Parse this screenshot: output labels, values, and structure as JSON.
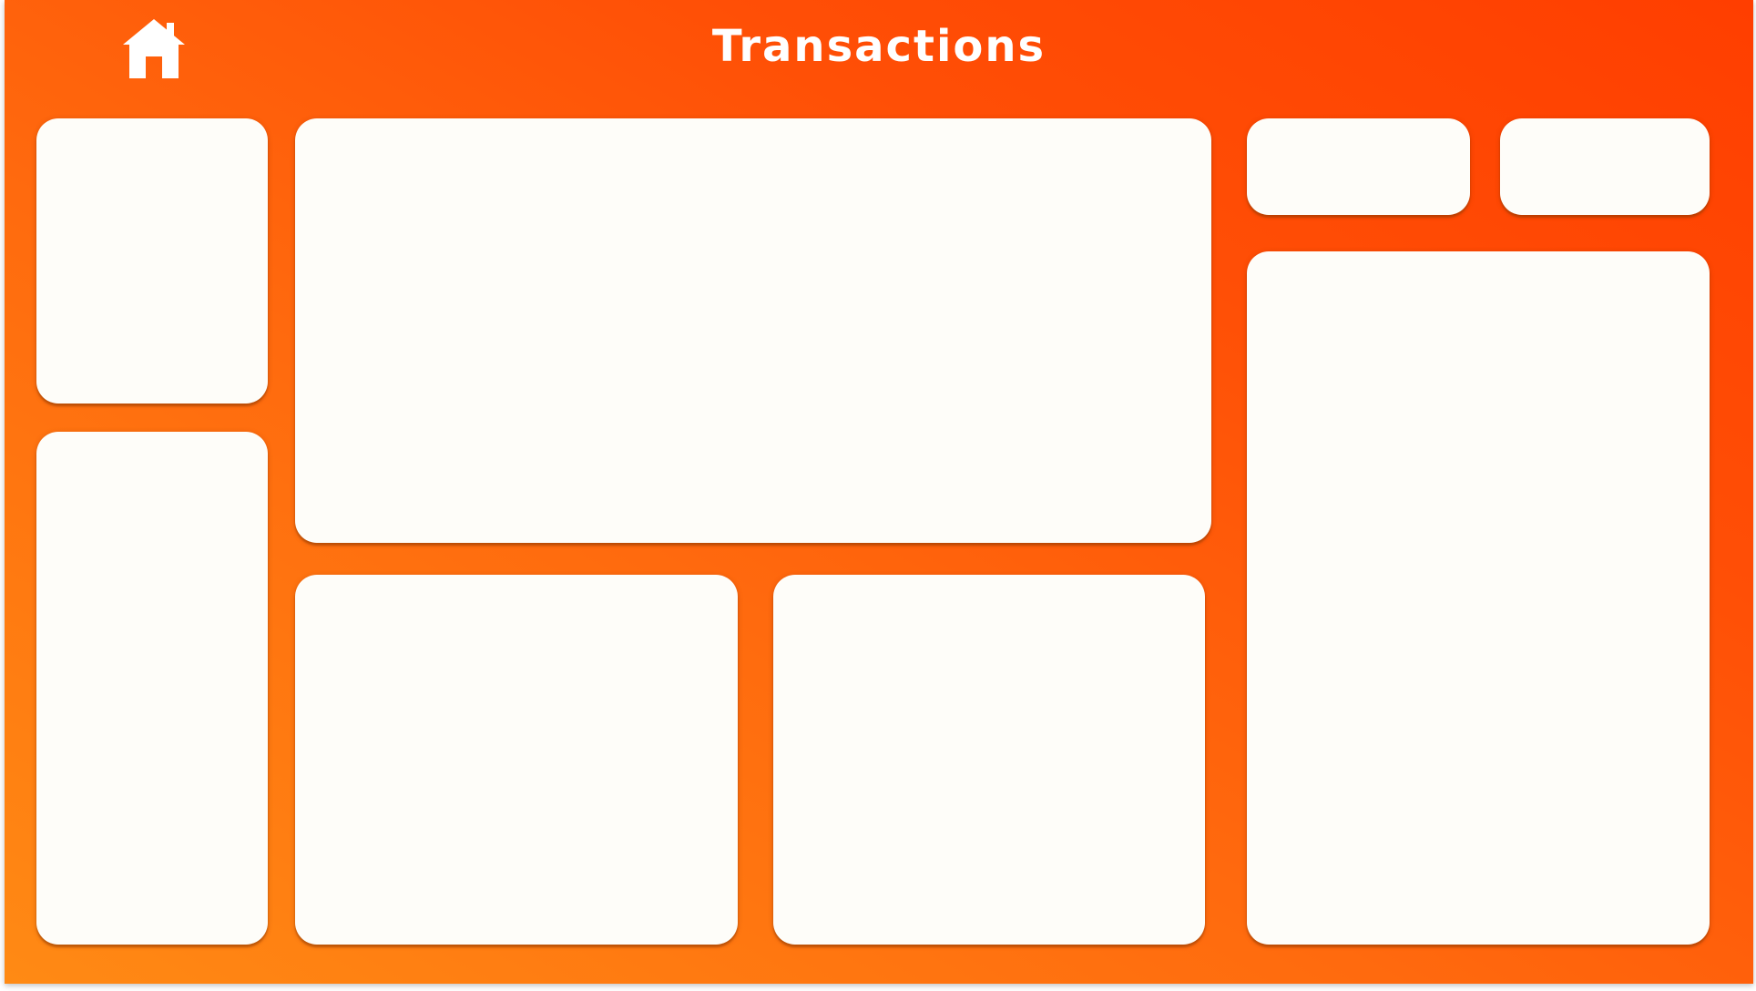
{
  "header": {
    "title": "Transactions",
    "home_icon": "home-icon"
  },
  "colors": {
    "background_gradient_start": "#ff8a14",
    "background_gradient_end": "#ff3e00",
    "card_background": "#fefdf9",
    "title_color": "#ffffff"
  },
  "panels": [
    {
      "id": "left-top"
    },
    {
      "id": "left-bottom"
    },
    {
      "id": "center-top"
    },
    {
      "id": "center-bottom-left"
    },
    {
      "id": "center-bottom-right"
    },
    {
      "id": "right-top-left"
    },
    {
      "id": "right-top-right"
    },
    {
      "id": "right-tall"
    }
  ]
}
